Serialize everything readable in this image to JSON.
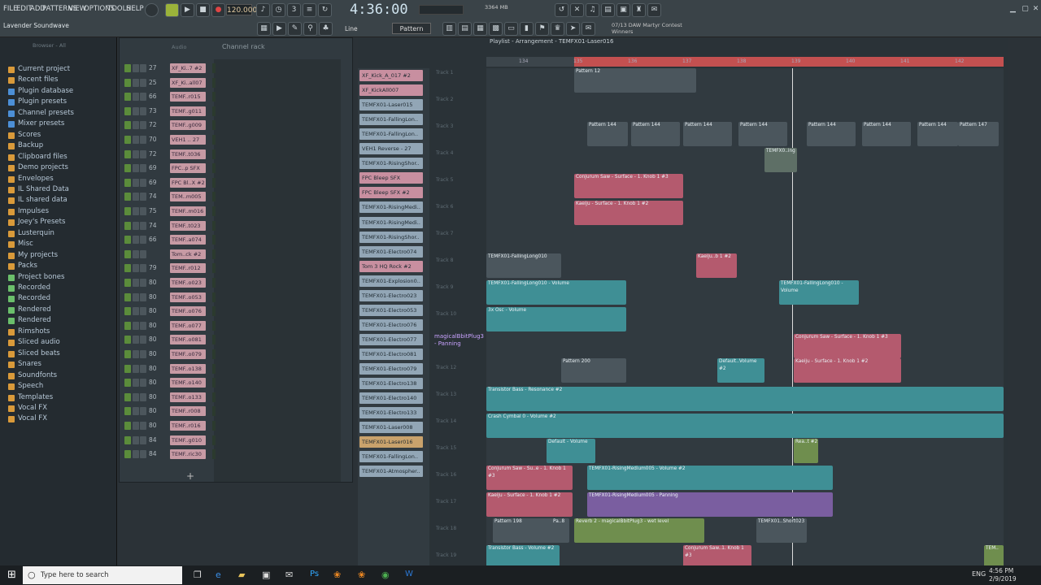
{
  "menu": [
    "FILE",
    "EDIT",
    "ADD",
    "PATTERNS",
    "VIEW",
    "OPTIONS",
    "TOOLS",
    "HELP"
  ],
  "song_name": "Lavender Soundwave",
  "tempo": "120.000",
  "time": "4:36:00",
  "cpu": "3364 MB",
  "pattern": "Pattern 226",
  "snap": "Line",
  "mix_text": [
    "07/13 DAW Martyr Contest",
    "Winners"
  ],
  "playlist_title": "Playlist - Arrangement - TEMFX01-Laser016",
  "browser": {
    "header": "Browser - All",
    "items": [
      "Current project",
      "Recent files",
      "Plugin database",
      "Plugin presets",
      "Channel presets",
      "Mixer presets",
      "Scores",
      "Backup",
      "Clipboard files",
      "Demo projects",
      "Envelopes",
      "IL Shared Data",
      "IL shared data",
      "Impulses",
      "Joey's Presets",
      "Lusterquin",
      "Misc",
      "My projects",
      "Packs",
      "Project bones",
      "Recorded",
      "Recorded",
      "Rendered",
      "Rendered",
      "Rimshots",
      "Sliced audio",
      "Sliced beats",
      "Snares",
      "Soundfonts",
      "Speech",
      "Templates",
      "Vocal FX",
      "Vocal FX"
    ]
  },
  "channel_rack": {
    "title": "Channel rack",
    "filter": "Audio",
    "rows": [
      {
        "num": "27",
        "name": "XF_Ki..7 #2"
      },
      {
        "num": "25",
        "name": "XF_Ki..all07"
      },
      {
        "num": "66",
        "name": "TEMF..r015"
      },
      {
        "num": "73",
        "name": "TEMF..g011"
      },
      {
        "num": "72",
        "name": "TEMF..g009"
      },
      {
        "num": "70",
        "name": "VEH1 .. 27"
      },
      {
        "num": "72",
        "name": "TEMF..t036"
      },
      {
        "num": "69",
        "name": "FPC..p SFX"
      },
      {
        "num": "69",
        "name": "FPC Bl..X #2"
      },
      {
        "num": "74",
        "name": "TEM..m005"
      },
      {
        "num": "75",
        "name": "TEMF..m016"
      },
      {
        "num": "74",
        "name": "TEMF..t023"
      },
      {
        "num": "66",
        "name": "TEMF..a074"
      },
      {
        "num": "",
        "name": "Tom..ck #2"
      },
      {
        "num": "79",
        "name": "TEMF..r012"
      },
      {
        "num": "80",
        "name": "TEMF..o023"
      },
      {
        "num": "80",
        "name": "TEMF..o053"
      },
      {
        "num": "80",
        "name": "TEMF..o076"
      },
      {
        "num": "80",
        "name": "TEMF..o077"
      },
      {
        "num": "80",
        "name": "TEMF..o081"
      },
      {
        "num": "80",
        "name": "TEMF..o079"
      },
      {
        "num": "80",
        "name": "TEMF..o138"
      },
      {
        "num": "80",
        "name": "TEMF..o140"
      },
      {
        "num": "80",
        "name": "TEMF..o133"
      },
      {
        "num": "80",
        "name": "TEMF..r008"
      },
      {
        "num": "80",
        "name": "TEMF..r016"
      },
      {
        "num": "84",
        "name": "TEMF..g010"
      },
      {
        "num": "84",
        "name": "TEMF..ric30"
      }
    ]
  },
  "track_names": [
    "XF_Kick_A_017 #2",
    "XF_KickAll007",
    "TEMFX01-Laser015",
    "TEMFX01-FallingLon..",
    "TEMFX01-FallingLon..",
    "VEH1 Reverse - 27",
    "TEMFX01-RisingShor..",
    "FPC Bleep SFX",
    "FPC Bleep SFX #2",
    "TEMFX01-RisingMedi..",
    "TEMFX01-RisingMedi..",
    "TEMFX01-RisingShor..",
    "TEMFX01-Electro074",
    "Tom 3 HQ Rock #2",
    "TEMFX01-Explosion0..",
    "TEMFX01-Electro023",
    "TEMFX01-Electro053",
    "TEMFX01-Electro076",
    "TEMFX01-Electro077",
    "TEMFX01-Electro081",
    "TEMFX01-Electro079",
    "TEMFX01-Electro138",
    "TEMFX01-Electro140",
    "TEMFX01-Electro133",
    "TEMFX01-Laser008",
    "TEMFX01-Laser016",
    "TEMFX01-FallingLon..",
    "TEMFX01-Atmospher.."
  ],
  "ruler": [
    "134",
    "135",
    "136",
    "137",
    "138",
    "139",
    "140",
    "141",
    "142"
  ],
  "track_labels": [
    "Track 1",
    "Track 2",
    "Track 3",
    "Track 4",
    "Track 5",
    "Track 6",
    "Track 7",
    "Track 8",
    "Track 9",
    "Track 10",
    "Track 11",
    "Track 12",
    "Track 13",
    "Track 14",
    "Track 15",
    "Track 16",
    "Track 17",
    "Track 18",
    "Track 19"
  ],
  "panning_label": "magicalBbitPlug3 - Panning",
  "clips": [
    {
      "t": "Pattern 12"
    },
    {
      "t": "Pattern 144"
    },
    {
      "t": "Pattern 144"
    },
    {
      "t": "Pattern 144"
    },
    {
      "t": "Pattern 144"
    },
    {
      "t": "Pattern 144"
    },
    {
      "t": "Pattern 144"
    },
    {
      "t": "Pattern 144"
    },
    {
      "t": "Pattern 147"
    },
    {
      "t": "TEMFX0..ing"
    },
    {
      "t": "Conjurum Saw - Surface - 1. Knob 1 #3"
    },
    {
      "t": "Kaeiju - Surface - 1. Knob 1 #2"
    },
    {
      "t": "TEMFX01-FallingLong010"
    },
    {
      "t": "Kaeiju..b 1 #2"
    },
    {
      "t": "TEMFX01-FallingLong010 - Volume"
    },
    {
      "t": "TEMFX01-FallingLong010 - Volume"
    },
    {
      "t": "3x Osc - Volume"
    },
    {
      "t": "Conjurum Saw - Surface - 1. Knob 1 #3"
    },
    {
      "t": "Pattern 200"
    },
    {
      "t": "Default..Volume #2"
    },
    {
      "t": "Kaeiju - Surface - 1. Knob 1 #2"
    },
    {
      "t": "Transistor Bass - Resonance #2"
    },
    {
      "t": "Crash Cymbal 0 - Volume #2"
    },
    {
      "t": "Default - Volume"
    },
    {
      "t": "Rea..t #2"
    },
    {
      "t": "Conjurum Saw - Su..e - 1. Knob 1 #3"
    },
    {
      "t": "TEMFX01-RisingMedium005 - Volume #2"
    },
    {
      "t": "Kaeiju - Surface - 1. Knob 1 #2"
    },
    {
      "t": "TEMFX01-RisingMedium005 - Panning"
    },
    {
      "t": "Pattern 198"
    },
    {
      "t": "Pa..8"
    },
    {
      "t": "Reverb 2 - magicalBbitPlug3 - wet level"
    },
    {
      "t": "TEMFX01..Short023"
    },
    {
      "t": "Transistor Bass - Volume #2"
    },
    {
      "t": "Conjurum Saw..1. Knob 1 #3"
    },
    {
      "t": "TEM.."
    }
  ],
  "taskbar": {
    "search": "Type here to search",
    "lang": "ENG",
    "clock": "4:56 PM",
    "date": "2/9/2019"
  }
}
